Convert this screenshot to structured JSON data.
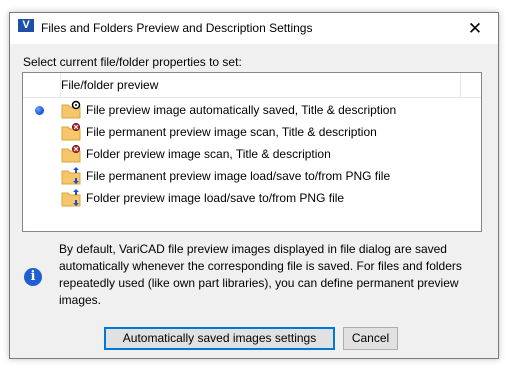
{
  "window": {
    "title": "Files and Folders Preview and Description Settings",
    "app_icon_letter": "V",
    "close_glyph": "✕"
  },
  "prompt": "Select current file/folder properties to set:",
  "list": {
    "header": "File/folder preview",
    "selected_index": 0,
    "items": [
      {
        "label": "File preview image automatically saved, Title & description",
        "icon": "folder-gear-icon"
      },
      {
        "label": "File permanent preview image scan, Title & description",
        "icon": "folder-scan-icon"
      },
      {
        "label": "Folder preview image scan, Title & description",
        "icon": "folder-scan-icon"
      },
      {
        "label": "File permanent preview image load/save to/from PNG file",
        "icon": "folder-load-save-icon"
      },
      {
        "label": "Folder preview image load/save to/from PNG file",
        "icon": "folder-load-save-icon"
      }
    ]
  },
  "info": {
    "icon": "info-icon",
    "text": "By default, VariCAD file preview images displayed in file dialog are saved automatically whenever the corresponding file is saved. For files and folders repeatedly used (like own part libraries), you can define permanent preview images."
  },
  "buttons": {
    "primary_label": "Automatically saved images settings",
    "cancel_label": "Cancel"
  },
  "colors": {
    "accent": "#0078d7",
    "folder": "#f5c66b",
    "folder_dark": "#d9a63a",
    "bullet": "#1a4fd0"
  }
}
